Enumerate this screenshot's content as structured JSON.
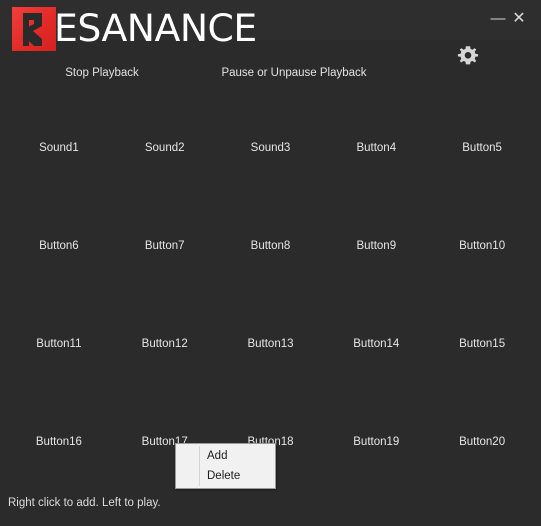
{
  "window": {
    "background_color": "#2b2b2b",
    "titlebar_color": "#2e2e2e",
    "minimize_label": "—",
    "close_label": "✕"
  },
  "branding": {
    "logo_mark_letter": "R",
    "logo_wordmark": "ESANANCE",
    "full_name": "RESANANCE",
    "accent_color": "#e32a27"
  },
  "header": {
    "stop_label": "Stop Playback",
    "pause_label": "Pause or Unpause Playback",
    "settings_icon": "gear-icon"
  },
  "pads": [
    {
      "label": "Sound1"
    },
    {
      "label": "Sound2"
    },
    {
      "label": "Sound3"
    },
    {
      "label": "Button4"
    },
    {
      "label": "Button5"
    },
    {
      "label": "Button6"
    },
    {
      "label": "Button7"
    },
    {
      "label": "Button8"
    },
    {
      "label": "Button9"
    },
    {
      "label": "Button10"
    },
    {
      "label": "Button11"
    },
    {
      "label": "Button12"
    },
    {
      "label": "Button13"
    },
    {
      "label": "Button14"
    },
    {
      "label": "Button15"
    },
    {
      "label": "Button16"
    },
    {
      "label": "Button17"
    },
    {
      "label": "Button18"
    },
    {
      "label": "Button19"
    },
    {
      "label": "Button20"
    }
  ],
  "context_menu": {
    "items": [
      {
        "label": "Add"
      },
      {
        "label": "Delete"
      }
    ]
  },
  "status_bar": {
    "hint": "Right click to add. Left to play."
  }
}
